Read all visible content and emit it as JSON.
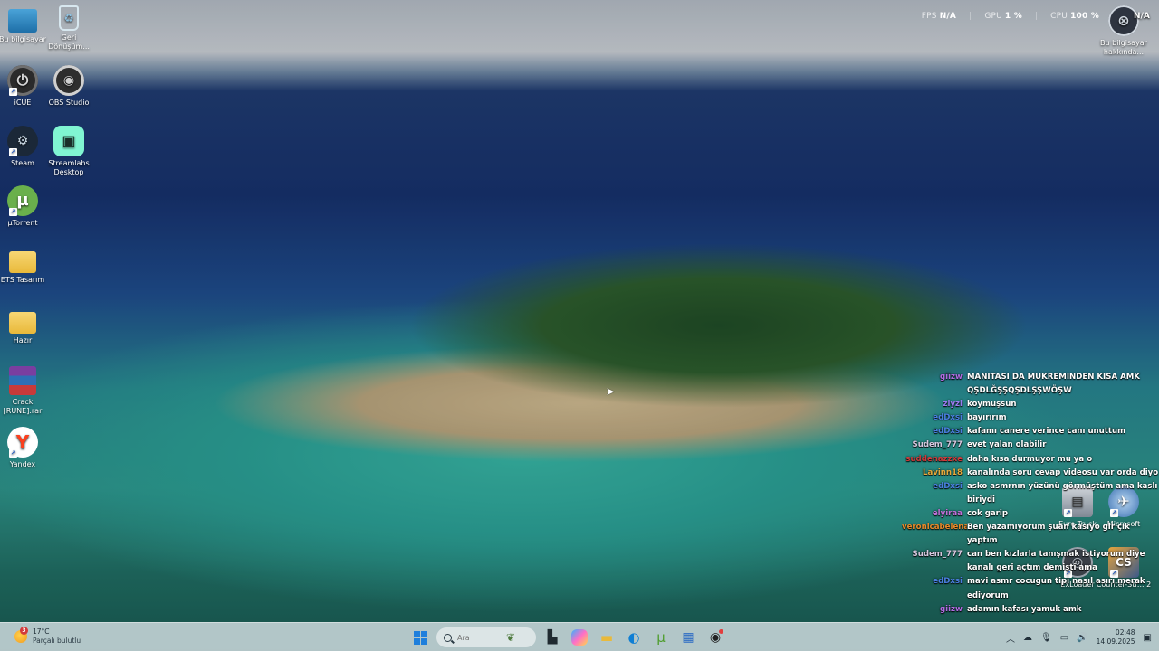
{
  "desktop": {
    "icons_left": [
      {
        "label": "Bu bilgisayar",
        "icon": "computer-icon"
      },
      {
        "label": "Geri Dönüşüm...",
        "icon": "recycle-bin-icon"
      },
      {
        "label": "iCUE",
        "icon": "icue-icon"
      },
      {
        "label": "OBS Studio",
        "icon": "obs-icon"
      },
      {
        "label": "Steam",
        "icon": "steam-icon"
      },
      {
        "label": "Streamlabs Desktop",
        "icon": "streamlabs-icon"
      },
      {
        "label": "µTorrent",
        "icon": "utorrent-icon"
      },
      {
        "label": "ETS Tasarım",
        "icon": "folder-icon"
      },
      {
        "label": "Hazır",
        "icon": "folder-icon"
      },
      {
        "label": "Crack [RUNE].rar",
        "icon": "winrar-icon"
      },
      {
        "label": "Yandex",
        "icon": "yandex-icon"
      }
    ],
    "icons_right": [
      {
        "label": "Bu bilgisayar hakkında...",
        "icon": "info-icon"
      },
      {
        "label": "Euro Truck",
        "icon": "truck-icon"
      },
      {
        "label": "Microsoft",
        "icon": "flight-icon"
      },
      {
        "label": "ExLoader",
        "icon": "exloader-icon"
      },
      {
        "label": "Counter-Str... 2",
        "icon": "cs2-icon"
      }
    ]
  },
  "stats": {
    "fps_label": "FPS",
    "fps_value": "N/A",
    "gpu_label": "GPU",
    "gpu_value": "1 %",
    "cpu_label": "CPU",
    "cpu_value": "100 %",
    "extra_value": "N/A"
  },
  "chat": [
    {
      "user": "giizw",
      "color": "#b06ae0",
      "message": "MANITASI DA MUKREMINDEN KISA AMK QŞDLĞŞŞQŞDLŞŞWÖŞW"
    },
    {
      "user": "ziyzi",
      "color": "#9a7cf0",
      "message": "koymuşsun"
    },
    {
      "user": "edDxsi",
      "color": "#4a7ee0",
      "message": "bayırırım"
    },
    {
      "user": "edDxsi",
      "color": "#4a7ee0",
      "message": "kafamı canere verince canı unuttum"
    },
    {
      "user": "Sudem_777",
      "color": "#d8c8e0",
      "message": "evet yalan olabilir"
    },
    {
      "user": "suddenazzxe",
      "color": "#d03a3a",
      "message": "daha kısa durmuyor mu ya o"
    },
    {
      "user": "Lavinn18",
      "color": "#e8a83a",
      "message": "kanalında soru cevap videosu var orda diyo"
    },
    {
      "user": "edDxsi",
      "color": "#4a7ee0",
      "message": "asko asmrnın yüzünü görmüştüm ama kaslı biriydi"
    },
    {
      "user": "elyiraa",
      "color": "#c070d8",
      "message": "cok garip"
    },
    {
      "user": "veronicabelenay",
      "color": "#e88a2a",
      "message": "Ben yazamıyorum şuan kasıyo gir çık yaptım"
    },
    {
      "user": "Sudem_777",
      "color": "#d8c8e0",
      "message": "can ben kızlarla tanışmak istiyorum diye kanalı geri açtım demişti ama"
    },
    {
      "user": "edDxsi",
      "color": "#4a7ee0",
      "message": "mavi asmr cocugun tipi nasıl asırı merak ediyorum"
    },
    {
      "user": "giizw",
      "color": "#b06ae0",
      "message": "adamın kafası yamuk amk"
    }
  ],
  "taskbar": {
    "weather_temp": "17°C",
    "weather_desc": "Parçalı bulutlu",
    "weather_badge": "3",
    "search_placeholder": "Ara",
    "time": "02:48",
    "date": "14.09.2025"
  }
}
